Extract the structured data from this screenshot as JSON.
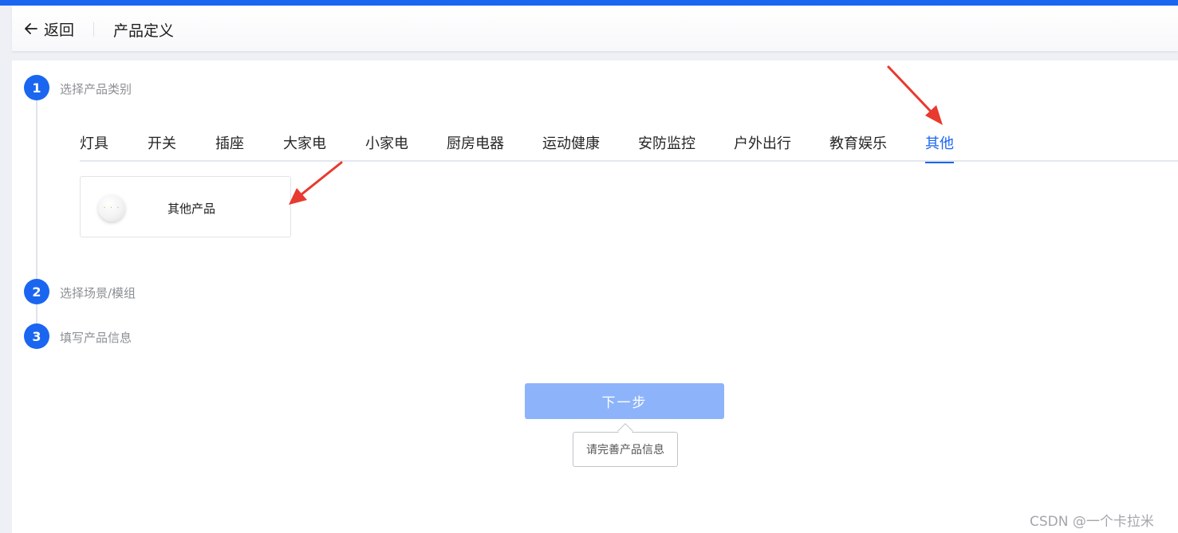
{
  "header": {
    "back_label": "返回",
    "title": "产品定义"
  },
  "steps": [
    {
      "number": "1",
      "label": "选择产品类别"
    },
    {
      "number": "2",
      "label": "选择场景/模组"
    },
    {
      "number": "3",
      "label": "填写产品信息"
    }
  ],
  "categories": {
    "tabs": [
      "灯具",
      "开关",
      "插座",
      "大家电",
      "小家电",
      "厨房电器",
      "运动健康",
      "安防监控",
      "户外出行",
      "教育娱乐",
      "其他"
    ],
    "active": "其他"
  },
  "product": {
    "name": "其他产品",
    "icon_glyph": "· · ·"
  },
  "actions": {
    "next_label": "下一步",
    "tooltip": "请完善产品信息"
  },
  "watermark": "CSDN @一个卡拉米",
  "colors": {
    "accent": "#1a66f0",
    "button_disabled": "#8db4fb",
    "annotation_arrow": "#e83a2f"
  }
}
